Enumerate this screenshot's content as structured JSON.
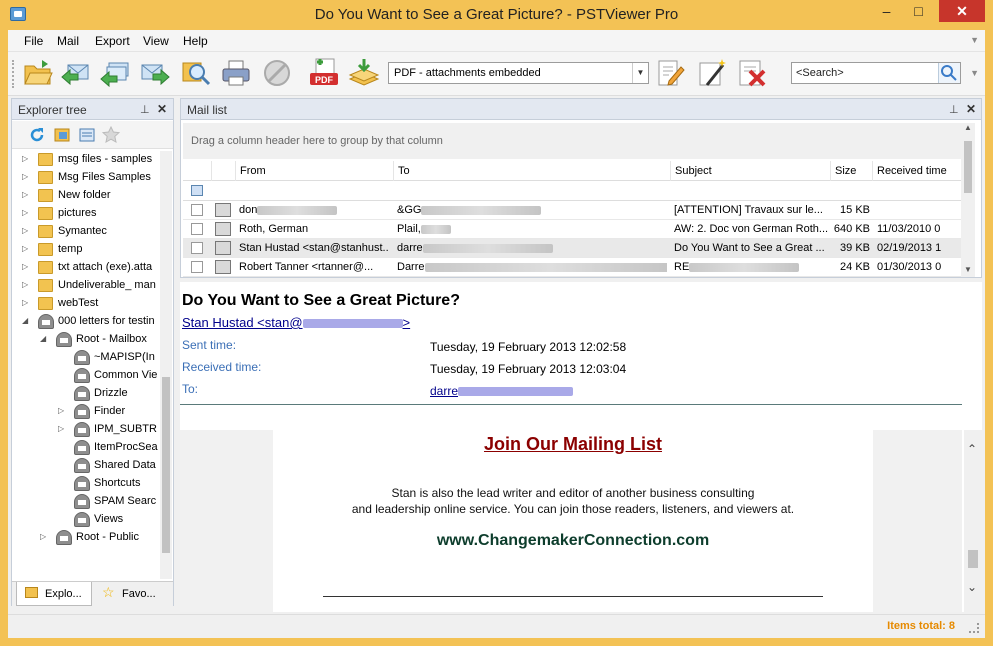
{
  "window": {
    "title": "Do You Want to See a Great Picture? - PSTViewer Pro",
    "minimize": "–",
    "maximize": "□",
    "close": "✕"
  },
  "menu": [
    "File",
    "Mail",
    "Export",
    "View",
    "Help"
  ],
  "toolbar": {
    "icons": [
      "open-folder-icon",
      "reply-icon",
      "reply-all-icon",
      "forward-icon",
      "find-icon",
      "print-icon",
      "stop-icon",
      "export-pdf-icon",
      "save-attachments-icon",
      "edit-icon",
      "wizard-icon",
      "delete-icon"
    ],
    "export_format": "PDF - attachments embedded",
    "search_placeholder": "<Search>"
  },
  "explorer": {
    "title": "Explorer tree",
    "tree": [
      {
        "label": "msg files - samples",
        "level": 0,
        "type": "folder",
        "expander": "▷"
      },
      {
        "label": "Msg Files Samples",
        "level": 0,
        "type": "folder",
        "expander": "▷"
      },
      {
        "label": "New folder",
        "level": 0,
        "type": "folder",
        "expander": "▷"
      },
      {
        "label": "pictures",
        "level": 0,
        "type": "folder",
        "expander": "▷"
      },
      {
        "label": "Symantec",
        "level": 0,
        "type": "folder",
        "expander": "▷"
      },
      {
        "label": "temp",
        "level": 0,
        "type": "folder",
        "expander": "▷"
      },
      {
        "label": "txt attach (exe).atta",
        "level": 0,
        "type": "folder",
        "expander": "▷"
      },
      {
        "label": "Undeliverable_ man",
        "level": 0,
        "type": "folder",
        "expander": "▷"
      },
      {
        "label": "webTest",
        "level": 0,
        "type": "folder",
        "expander": "▷"
      },
      {
        "label": "000 letters for testin",
        "level": 0,
        "type": "mailbox",
        "expander": "◢"
      },
      {
        "label": "Root - Mailbox",
        "level": 1,
        "type": "mailbox",
        "expander": "◢"
      },
      {
        "label": "~MAPISP(In",
        "level": 2,
        "type": "mailbox",
        "expander": ""
      },
      {
        "label": "Common Vie",
        "level": 2,
        "type": "mailbox",
        "expander": ""
      },
      {
        "label": "Drizzle",
        "level": 2,
        "type": "mailbox",
        "expander": ""
      },
      {
        "label": "Finder",
        "level": 2,
        "type": "mailbox",
        "expander": "▷"
      },
      {
        "label": "IPM_SUBTR",
        "level": 2,
        "type": "mailbox",
        "expander": "▷"
      },
      {
        "label": "ItemProcSea",
        "level": 2,
        "type": "mailbox",
        "expander": ""
      },
      {
        "label": "Shared Data",
        "level": 2,
        "type": "mailbox",
        "expander": ""
      },
      {
        "label": "Shortcuts",
        "level": 2,
        "type": "mailbox",
        "expander": ""
      },
      {
        "label": "SPAM Searc",
        "level": 2,
        "type": "mailbox",
        "expander": ""
      },
      {
        "label": "Views",
        "level": 2,
        "type": "mailbox",
        "expander": ""
      },
      {
        "label": "Root - Public",
        "level": 1,
        "type": "mailbox",
        "expander": "▷"
      }
    ],
    "tabs": [
      "Explo...",
      "Favo..."
    ]
  },
  "maillist": {
    "title": "Mail list",
    "group_hint": "Drag a column header here to group by that column",
    "columns": [
      "From",
      "To",
      "Subject",
      "Size",
      "Received time"
    ],
    "rows": [
      {
        "from": "don",
        "to": "&GG",
        "subject": "[ATTENTION] Travaux sur le...",
        "size": "15 KB",
        "received": ""
      },
      {
        "from": "Roth, German",
        "to": "Plail,",
        "subject": "AW: 2. Doc von German Roth...",
        "size": "640 KB",
        "received": "11/03/2010 0"
      },
      {
        "from": "Stan Hustad <stan@stanhust...",
        "to": "darre",
        "subject": "Do You Want to See a Great ...",
        "size": "39 KB",
        "received": "02/19/2013 1"
      },
      {
        "from": "Robert Tanner <rtanner@...",
        "to": "Darre",
        "subject": "RE",
        "size": "24 KB",
        "received": "01/30/2013 0"
      }
    ]
  },
  "preview": {
    "subject": "Do You Want to See a Great Picture?",
    "from": "Stan Hustad <stan@",
    "from_end": ">",
    "sent_label": "Sent time:",
    "sent_value": "Tuesday, 19 February 2013 12:02:58",
    "received_label": "Received time:",
    "received_value": "Tuesday, 19 February 2013 12:03:04",
    "to_label": "To:",
    "to_value": "darre",
    "body": {
      "heading": "Join Our Mailing List",
      "line1": "Stan is also the lead writer and editor of another business consulting",
      "line2": "and leadership online service.  You can join those readers, listeners, and viewers at.",
      "site": "www.ChangemakerConnection.com"
    }
  },
  "status": {
    "items_total": "Items total: 8"
  }
}
